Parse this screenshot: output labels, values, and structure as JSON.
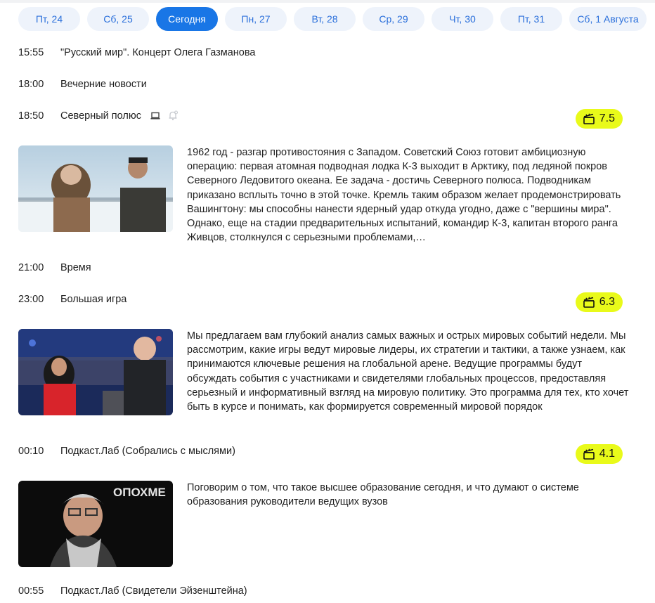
{
  "days": [
    {
      "label": "Пт, 24"
    },
    {
      "label": "Сб, 25"
    },
    {
      "label": "Сегодня",
      "active": true
    },
    {
      "label": "Пн, 27"
    },
    {
      "label": "Вт, 28"
    },
    {
      "label": "Ср, 29"
    },
    {
      "label": "Чт, 30"
    },
    {
      "label": "Пт, 31"
    },
    {
      "label": "Сб, 1 Августа"
    }
  ],
  "programs": [
    {
      "time": "15:55",
      "title": "\"Русский мир\". Концерт Олега Газманова"
    },
    {
      "time": "18:00",
      "title": "Вечерние новости"
    },
    {
      "time": "18:50",
      "title": "Северный полюс",
      "icons": [
        "laptop-icon",
        "bell-icon"
      ],
      "rating": "7.5",
      "image": "arctic-scene",
      "description": "1962 год - разгар противостояния с Западом. Советский Союз готовит амбициозную операцию: первая атомная подводная лодка К-3 выходит в Арктику, под ледяной покров Северного Ледовитого океана. Ее задача - достичь Северного полюса. Подводникам приказано всплыть точно в этой точке. Кремль таким образом желает продемонстрировать Вашингтону: мы способны нанести ядерный удар откуда угодно, даже с \"вершины мира\". Однако, еще на стадии предварительных испытаний, командир К-3, капитан второго ранга Живцов, столкнулся с серьезными проблемами,…"
    },
    {
      "time": "21:00",
      "title": "Время"
    },
    {
      "time": "23:00",
      "title": "Большая игра",
      "rating": "6.3",
      "image": "tv-studio",
      "description": "Мы предлагаем вам глубокий анализ самых важных и острых мировых событий недели. Мы рассмотрим, какие игры ведут мировые лидеры, их стратегии и тактики, а также узнаем, как принимаются ключевые решения на глобальной арене. Ведущие программы будут обсуждать события с участниками и свидетелями глобальных процессов, предоставляя серьезный и информативный взгляд на мировую политику. Это программа для тех, кто хочет быть в курсе и понимать, как формируется современный мировой порядок"
    },
    {
      "time": "00:10",
      "title": "Подкаст.Лаб (Собрались с мыслями)",
      "rating": "4.1",
      "image": "podcast-guest",
      "image_text": "ОПОХМЕ",
      "description": "Поговорим о том, что такое высшее образование сегодня, и что думают о системе образования руководители ведущих вузов"
    },
    {
      "time": "00:55",
      "title": "Подкаст.Лаб (Свидетели Эйзенштейна)"
    }
  ],
  "colors": {
    "accent": "#1976e6",
    "tab_bg": "#eef3fb",
    "rating_bg": "#e9fa1a"
  }
}
